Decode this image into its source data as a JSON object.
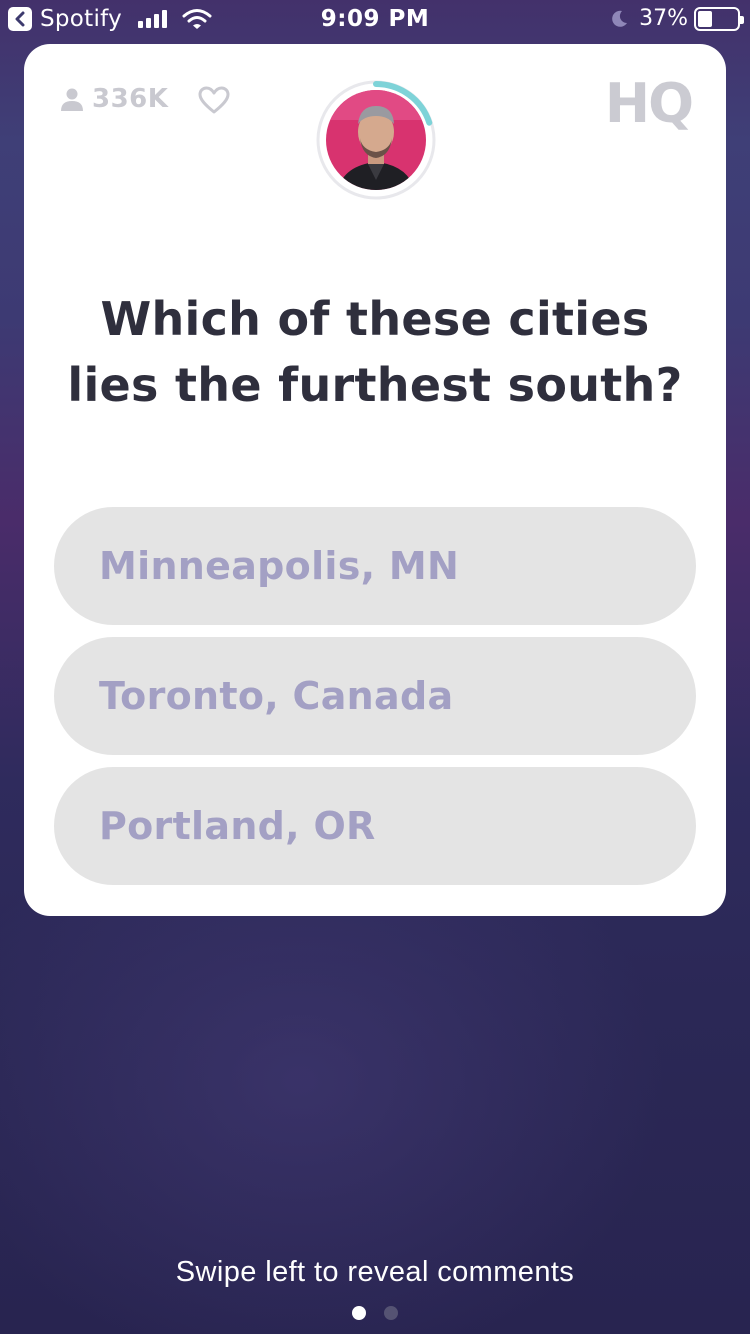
{
  "status_bar": {
    "back_app_label": "Spotify",
    "time": "9:09 PM",
    "battery_percent_text": "37%",
    "battery_level": 0.37,
    "signal_bars": 4,
    "icons": [
      "back-arrow-icon",
      "signal-icon",
      "wifi-icon",
      "moon-icon",
      "battery-icon"
    ]
  },
  "game": {
    "viewer_count": "336K",
    "logo_text": "HQ",
    "timer_progress": 0.2,
    "timer_color": "#7ed3d8",
    "question": "Which of these cities lies the furthest south?",
    "answers": [
      {
        "label": "Minneapolis, MN"
      },
      {
        "label": "Toronto, Canada"
      },
      {
        "label": "Portland, OR"
      }
    ],
    "icons": [
      "person-icon",
      "heart-icon",
      "host-avatar"
    ]
  },
  "footer": {
    "hint": "Swipe left to reveal comments",
    "page_count": 2,
    "active_page": 1
  },
  "colors": {
    "card_bg": "#ffffff",
    "answer_bg": "#e4e4e4",
    "answer_text": "#a3a0c4",
    "question_text": "#2f2f3d",
    "muted_gray": "#c9c9d0"
  }
}
